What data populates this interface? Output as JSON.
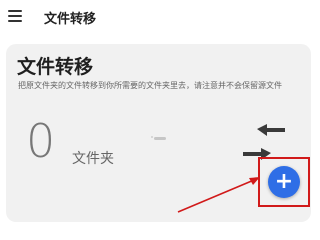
{
  "appbar": {
    "title": "文件转移",
    "menu_icon": "menu-icon"
  },
  "card": {
    "title": "文件转移",
    "description": "把原文件夹的文件转移到你所需要的文件夹里去，请注意并不会保留源文件",
    "count": "0",
    "count_unit": "文件夹",
    "transfer_icon": "transfer-arrows-icon"
  },
  "fab": {
    "label": "+",
    "icon": "add-icon",
    "color": "#2F6EE6"
  },
  "annotation": {
    "color": "#D11A1A"
  }
}
